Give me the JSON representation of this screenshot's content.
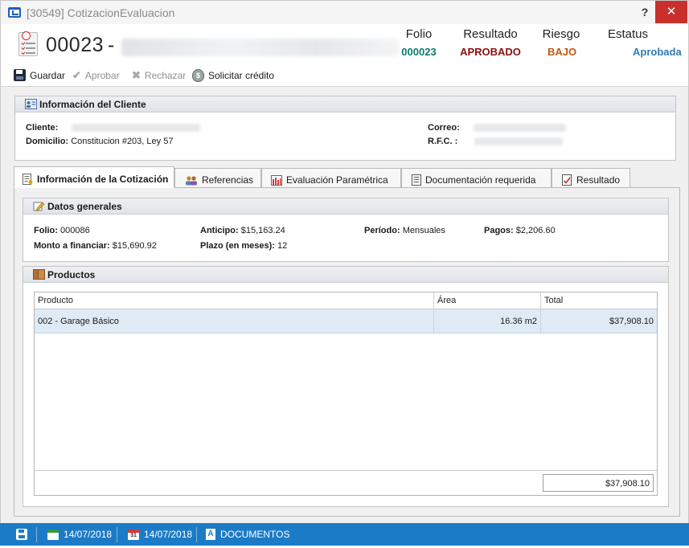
{
  "window": {
    "title": "[30549] CotizacionEvaluacion",
    "help_label": "?",
    "close_label": "✕"
  },
  "header": {
    "number": "00023",
    "dash": "-",
    "columns": [
      {
        "label": "Folio",
        "value": "000023",
        "color": "#0b7a6f"
      },
      {
        "label": "Resultado",
        "value": "APROBADO",
        "color": "#8b0f0f"
      },
      {
        "label": "Riesgo",
        "value": "BAJO",
        "color": "#c0580f"
      },
      {
        "label": "Estatus",
        "value": "Aprobada",
        "color": "#2f7bb5"
      }
    ]
  },
  "toolbar": {
    "save_label": "Guardar",
    "approve_label": "Aprobar",
    "reject_label": "Rechazar",
    "credit_label": "Solicitar crédito"
  },
  "client_panel": {
    "title": "Información del Cliente",
    "cliente_label": "Cliente:",
    "domicilio_label": "Domicilio:",
    "domicilio_value": "Constitucion  #203, Ley 57",
    "correo_label": "Correo:",
    "rfc_label": "R.F.C. :"
  },
  "tabs": [
    {
      "label": "Información de la Cotización",
      "icon": "quote-doc-icon"
    },
    {
      "label": "Referencias",
      "icon": "people-icon"
    },
    {
      "label": "Evaluación Paramétrica",
      "icon": "bar-chart-icon"
    },
    {
      "label": "Documentación requerida",
      "icon": "document-list-icon"
    },
    {
      "label": "Resultado",
      "icon": "result-icon"
    }
  ],
  "datos_generales": {
    "title": "Datos generales",
    "folio_label": "Folio:",
    "folio_value": "000086",
    "monto_label": "Monto a financiar:",
    "monto_value": "$15,690.92",
    "anticipo_label": "Anticipo:",
    "anticipo_value": "$15,163.24",
    "plazo_label": "Plazo (en meses):",
    "plazo_value": "12",
    "periodo_label": "Período:",
    "periodo_value": "Mensuales",
    "pagos_label": "Pagos:",
    "pagos_value": "$2,206.60"
  },
  "productos": {
    "title": "Productos",
    "columns": [
      "Producto",
      "Área",
      "Total"
    ],
    "rows": [
      {
        "producto": "002 - Garage Básico",
        "area": "16.36 m2",
        "total": "$37,908.10"
      }
    ],
    "total": "$37,908.10"
  },
  "statusbar": {
    "date1": "14/07/2018",
    "date2": "14/07/2018",
    "documents_label": "DOCUMENTOS",
    "calendar_day": "31"
  }
}
